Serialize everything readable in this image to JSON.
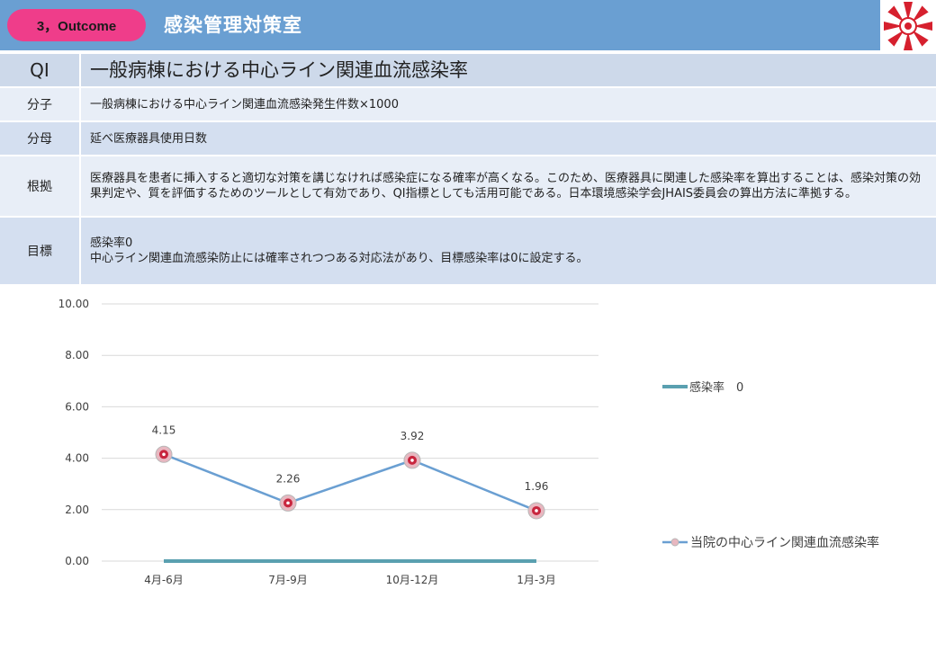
{
  "header": {
    "badge": "3，Outcome",
    "department": "感染管理対策室"
  },
  "qi": {
    "label": "QI",
    "title": "一般病棟における中心ライン関連血流感染率"
  },
  "rows": {
    "numerator": {
      "label": "分子",
      "text": "一般病棟における中心ライン関連血流感染発生件数×1000"
    },
    "denominator": {
      "label": "分母",
      "text": "延べ医療器具使用日数"
    },
    "basis": {
      "label": "根拠",
      "text": "医療器具を患者に挿入すると適切な対策を講じなければ感染症になる確率が高くなる。このため、医療器具に関連した感染率を算出することは、感染対策の効果判定や、質を評価するためのツールとして有効であり、QI指標としても活用可能である。日本環境感染学会JHAIS委員会の算出方法に準拠する。"
    },
    "target": {
      "label": "目標",
      "line1": "感染率0",
      "line2": "中心ライン関連血流感染防止には確率されつつある対応法があり、目標感染率は0に設定する。"
    }
  },
  "colors": {
    "header": "#6a9fd2",
    "badge": "#ef3d8a",
    "hospital_line": "#6a9fd2",
    "target_line": "#5aa0b0",
    "marker": "#c8263e"
  },
  "icons": {
    "logo": "hospital-emblem-icon"
  },
  "chart_data": {
    "type": "line",
    "categories": [
      "4月-6月",
      "7月-9月",
      "10月-12月",
      "1月-3月"
    ],
    "series": [
      {
        "name": "当院の中心ライン関連血流感染率",
        "values": [
          4.15,
          2.26,
          3.92,
          1.96
        ],
        "data_labels": [
          "4.15",
          "2.26",
          "3.92",
          "1.96"
        ]
      },
      {
        "name": "感染率　0",
        "values": [
          0,
          0,
          0,
          0
        ]
      }
    ],
    "y_ticks": [
      "0.00",
      "2.00",
      "4.00",
      "6.00",
      "8.00",
      "10.00"
    ],
    "ylim": [
      0,
      10
    ],
    "grid": true,
    "legend_position": "right"
  }
}
